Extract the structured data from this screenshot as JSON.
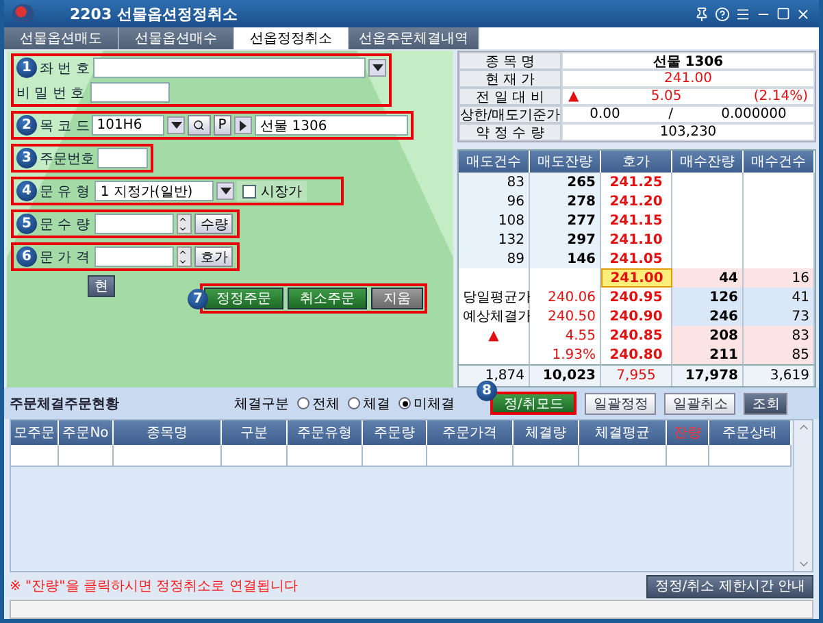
{
  "window": {
    "title": "2203 선물옵션정정취소"
  },
  "tabs": [
    {
      "label": "선물옵션매도",
      "selected": false
    },
    {
      "label": "선물옵션매수",
      "selected": false
    },
    {
      "label": "선옵정정취소",
      "selected": true
    },
    {
      "label": "선옵주문체결내역",
      "selected": false
    }
  ],
  "form": {
    "account": {
      "badge": "1",
      "label": "좌 번 호"
    },
    "password": {
      "label": "비 밀 번 호"
    },
    "code": {
      "badge": "2",
      "label": "목 코 드",
      "value": "101H6",
      "button": "P",
      "name": "선물 1306"
    },
    "order_no": {
      "badge": "3",
      "label": "주문번호"
    },
    "order_type": {
      "badge": "4",
      "label": "문 유 형",
      "value": "1 지정가(일반)",
      "market": {
        "label": "시장가",
        "checked": false
      }
    },
    "quantity": {
      "badge": "5",
      "label": "문 수 량",
      "button": "수량"
    },
    "price": {
      "badge": "6",
      "label": "문 가 격",
      "button": "호가"
    },
    "current_button": "현",
    "actions": {
      "badge": "7",
      "buttons": [
        {
          "label": "정정주문",
          "kind": "primary"
        },
        {
          "label": "취소주문",
          "kind": "primary"
        },
        {
          "label": "지움",
          "kind": "secondary"
        }
      ]
    }
  },
  "info": [
    {
      "kind": "text",
      "label": "종 목 명",
      "value": "선물 1306",
      "bold": true
    },
    {
      "kind": "price",
      "label": "현 재 가",
      "value": "241.00"
    },
    {
      "kind": "change",
      "label": "전 일 대 비",
      "arrow": "▲",
      "value": "5.05",
      "rate": "(2.14%)"
    },
    {
      "kind": "pair",
      "label": "상한/매도기준가",
      "values": [
        "0.00",
        "/",
        "0.000000"
      ]
    },
    {
      "kind": "text",
      "label": "약 정 수 량",
      "value": "103,230",
      "bold": false
    }
  ],
  "orderbook": {
    "columns": [
      "매도건수",
      "매도잔량",
      "호가",
      "매수잔량",
      "매수건수"
    ],
    "asks": [
      {
        "count": "83",
        "qty": "265",
        "price": "241.25"
      },
      {
        "count": "96",
        "qty": "278",
        "price": "241.20"
      },
      {
        "count": "108",
        "qty": "277",
        "price": "241.15"
      },
      {
        "count": "132",
        "qty": "297",
        "price": "241.10"
      },
      {
        "count": "89",
        "qty": "146",
        "price": "241.05"
      }
    ],
    "bids": [
      {
        "price": "241.00",
        "qty": "44",
        "count": "16",
        "current": true,
        "color": "#fde4e4"
      },
      {
        "price": "240.95",
        "qty": "126",
        "count": "41",
        "current": false,
        "color": "#dae7f6"
      },
      {
        "price": "240.90",
        "qty": "246",
        "count": "73",
        "current": false,
        "color": "#dae7f6"
      },
      {
        "price": "240.85",
        "qty": "208",
        "count": "83",
        "current": false,
        "color": "#fde4e4"
      },
      {
        "price": "240.80",
        "qty": "211",
        "count": "85",
        "current": false,
        "color": "#fde4e4"
      }
    ],
    "stats": [
      {
        "kind": "text",
        "label": "당일평균가",
        "value": "240.06"
      },
      {
        "kind": "text",
        "label": "예상체결가",
        "value": "240.50"
      },
      {
        "kind": "arrow",
        "label": "▲",
        "value": "4.55"
      },
      {
        "kind": "blank",
        "value": "1.93%"
      }
    ],
    "totals": [
      "1,874",
      "10,023",
      "7,955",
      "17,978",
      "3,619"
    ]
  },
  "orders": {
    "title": "주문체결주문현황",
    "filter_label": "체결구분",
    "filters": [
      {
        "label": "전체",
        "selected": false
      },
      {
        "label": "체결",
        "selected": false
      },
      {
        "label": "미체결",
        "selected": true
      }
    ],
    "mode_button": {
      "badge": "8",
      "label": "정/취모드"
    },
    "buttons": [
      {
        "label": "일괄정정",
        "kind": "light"
      },
      {
        "label": "일괄취소",
        "kind": "light"
      },
      {
        "label": "조회",
        "kind": "dark"
      }
    ],
    "columns": [
      {
        "label": "모주문",
        "alert": false
      },
      {
        "label": "주문No",
        "alert": false
      },
      {
        "label": "종목명",
        "alert": false
      },
      {
        "label": "구분",
        "alert": false
      },
      {
        "label": "주문유형",
        "alert": false
      },
      {
        "label": "주문량",
        "alert": false
      },
      {
        "label": "주문가격",
        "alert": false
      },
      {
        "label": "체결량",
        "alert": false
      },
      {
        "label": "체결평균",
        "alert": false
      },
      {
        "label": "잔량",
        "alert": true
      },
      {
        "label": "주문상태",
        "alert": false
      }
    ],
    "note": "※ \"잔량\"을 클릭하시면 정정취소로 연결됩니다",
    "limit_button": "정정/취소 제한시간 안내"
  }
}
